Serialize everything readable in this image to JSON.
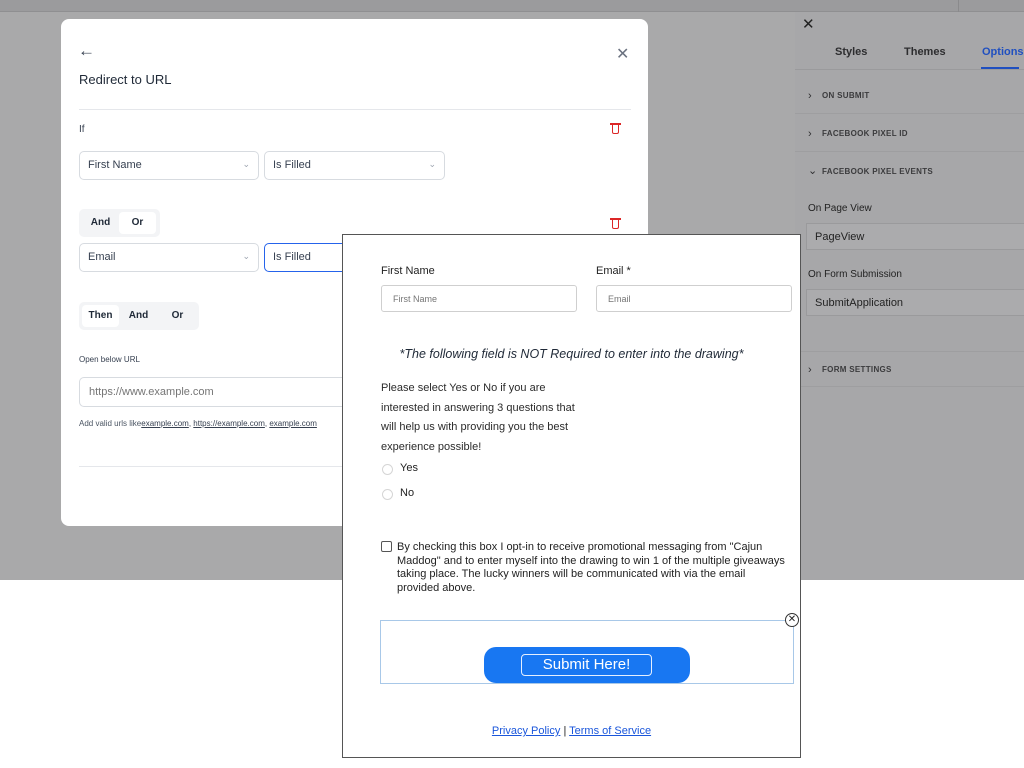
{
  "sidebar": {
    "tabs": [
      "Styles",
      "Themes",
      "Options"
    ],
    "sections": [
      "ON SUBMIT",
      "FACEBOOK PIXEL ID",
      "FACEBOOK PIXEL EVENTS",
      "FORM SETTINGS"
    ],
    "on_page_view_label": "On Page View",
    "on_page_view_value": "PageView",
    "on_form_submission_label": "On Form Submission",
    "on_form_submission_value": "SubmitApplication"
  },
  "modal": {
    "title": "Redirect to URL",
    "if_label": "If",
    "cond1_field": "First Name",
    "cond1_op": "Is Filled",
    "seg1": [
      "And",
      "Or"
    ],
    "cond2_field": "Email",
    "cond2_op": "Is Filled",
    "seg2": [
      "Then",
      "And",
      "Or"
    ],
    "url_label": "Open below URL",
    "url_placeholder": "https://www.example.com",
    "hint_prefix": "Add valid urls like",
    "hint_links": [
      "example.com",
      "https://example.com",
      "example.com"
    ]
  },
  "form": {
    "first_name_label": "First Name",
    "first_name_placeholder": "First Name",
    "email_label": "Email *",
    "email_placeholder": "Email",
    "heading": "*The following field is NOT Required to enter into the drawing*",
    "question": "Please select Yes or No if you are interested in answering 3 questions that will help us with providing you the best experience possible!",
    "option_yes": "Yes",
    "option_no": "No",
    "consent": "By checking this box I opt-in to receive promotional messaging from \"Cajun Maddog\" and to enter myself into the drawing to win 1 of the multiple giveaways taking place. The lucky winners will be communicated with via the email provided above.",
    "submit_label": "Submit Here!",
    "privacy_link": "Privacy Policy",
    "separator": "|",
    "terms_link": "Terms of Service"
  },
  "icons": {
    "back": "arrow-left",
    "close": "x",
    "delete": "trash",
    "chevron": "chevron"
  },
  "colors": {
    "accent": "#2563eb",
    "submit": "#1877f2",
    "delete": "#dc2626"
  }
}
